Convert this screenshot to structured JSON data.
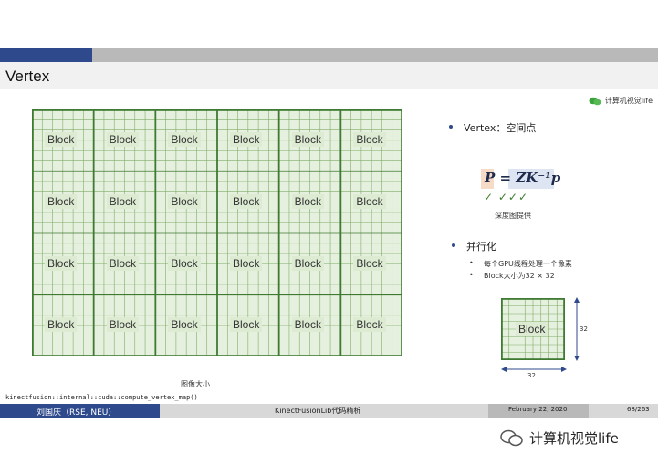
{
  "slide": {
    "title": "Vertex",
    "watermark_top": "计算机视觉life",
    "block_label": "Block",
    "image_size_caption": "图像大小",
    "code_ref": "kinectfusion::internal::cuda::compute_vertex_map()",
    "bullet1": "Vertex：空间点",
    "formula": "P = ZK⁻¹p",
    "checks": "✓ ✓✓✓",
    "formula_note": "深度图提供",
    "bullet2": "并行化",
    "sub_bullets": [
      "每个GPU线程处理一个像素",
      "Block大小为32 × 32"
    ],
    "dim_height": "32",
    "dim_width": "32"
  },
  "footer": {
    "author": "刘国庆（RSE, NEU）",
    "topic": "KinectFusionLib代码精析",
    "date": "February 22, 2020",
    "page": "68/263"
  },
  "watermark_bottom": "计算机视觉life",
  "colors": {
    "accent_blue": "#2f4a8c",
    "grid_green": "#4a8a3c",
    "cell_fill": "#ddebd3"
  }
}
